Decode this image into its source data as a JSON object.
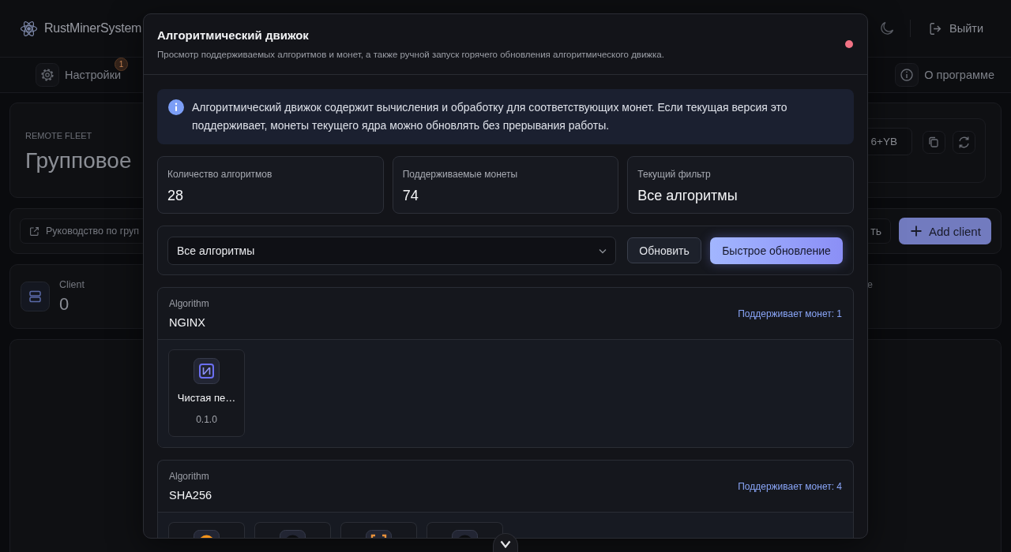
{
  "header": {
    "logo": "RustMinerSystem",
    "logout": "Выйти"
  },
  "nav": {
    "settings": {
      "label": "Настройки",
      "badge": "1"
    },
    "about": {
      "label": "О программе"
    }
  },
  "fleet": {
    "eyebrow": "REMOTE FLEET",
    "title": "Групповое",
    "token": "6+YB"
  },
  "toolbar": {
    "guide": "Руководство по груп",
    "button_2": "ть",
    "add": "Add client"
  },
  "stats": [
    {
      "label": "Client",
      "value": "0"
    },
    {
      "label": "e"
    }
  ],
  "modal": {
    "title": "Алгоритмический движок",
    "subtitle": "Просмотр поддерживаемых алгоритмов и монет, а также ручной запуск горячего обновления алгоритмического движка.",
    "notice": "Алгоритмический движок содержит вычисления и обработку для соответствующих монет. Если текущая версия это поддерживает, монеты текущего ядра можно обновлять без прерывания работы.",
    "metrics": [
      {
        "label": "Количество алгоритмов",
        "value": "28"
      },
      {
        "label": "Поддерживаемые монеты",
        "value": "74"
      },
      {
        "label": "Текущий фильтр",
        "value": "Все алгоритмы"
      }
    ],
    "filter": {
      "value": "Все алгоритмы"
    },
    "actions": [
      {
        "label": "Обновить",
        "kind": "secondary"
      },
      {
        "label": "Быстрое обновление",
        "kind": "primary"
      }
    ],
    "algorithms": [
      {
        "label": "Algorithm",
        "name": "NGINX",
        "support": "Поддерживает монет: 1",
        "coins": [
          {
            "kind": "logo",
            "name": "Чистая пе…",
            "version": "0.1.0"
          }
        ]
      },
      {
        "label": "Algorithm",
        "name": "SHA256",
        "support": "Поддерживает монет: 4",
        "coins": [
          {
            "kind": "coin"
          },
          {
            "kind": "dark-coin"
          },
          {
            "kind": "bracket"
          },
          {
            "kind": "dark-coin"
          }
        ]
      }
    ]
  }
}
